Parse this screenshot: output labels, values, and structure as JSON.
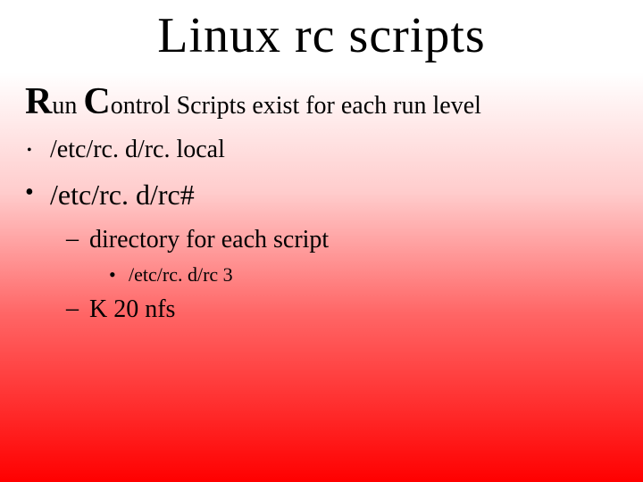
{
  "title": "Linux rc scripts",
  "subtitle": {
    "r": "R",
    "un": "un ",
    "c": "C",
    "rest": "ontrol Scripts exist for each run level"
  },
  "items": {
    "l1a": "/etc/rc. d/rc. local",
    "l1b": "/etc/rc. d/rc#",
    "l2a": "directory for each script",
    "l3a": "/etc/rc. d/rc 3",
    "l2b": "K 20 nfs"
  }
}
